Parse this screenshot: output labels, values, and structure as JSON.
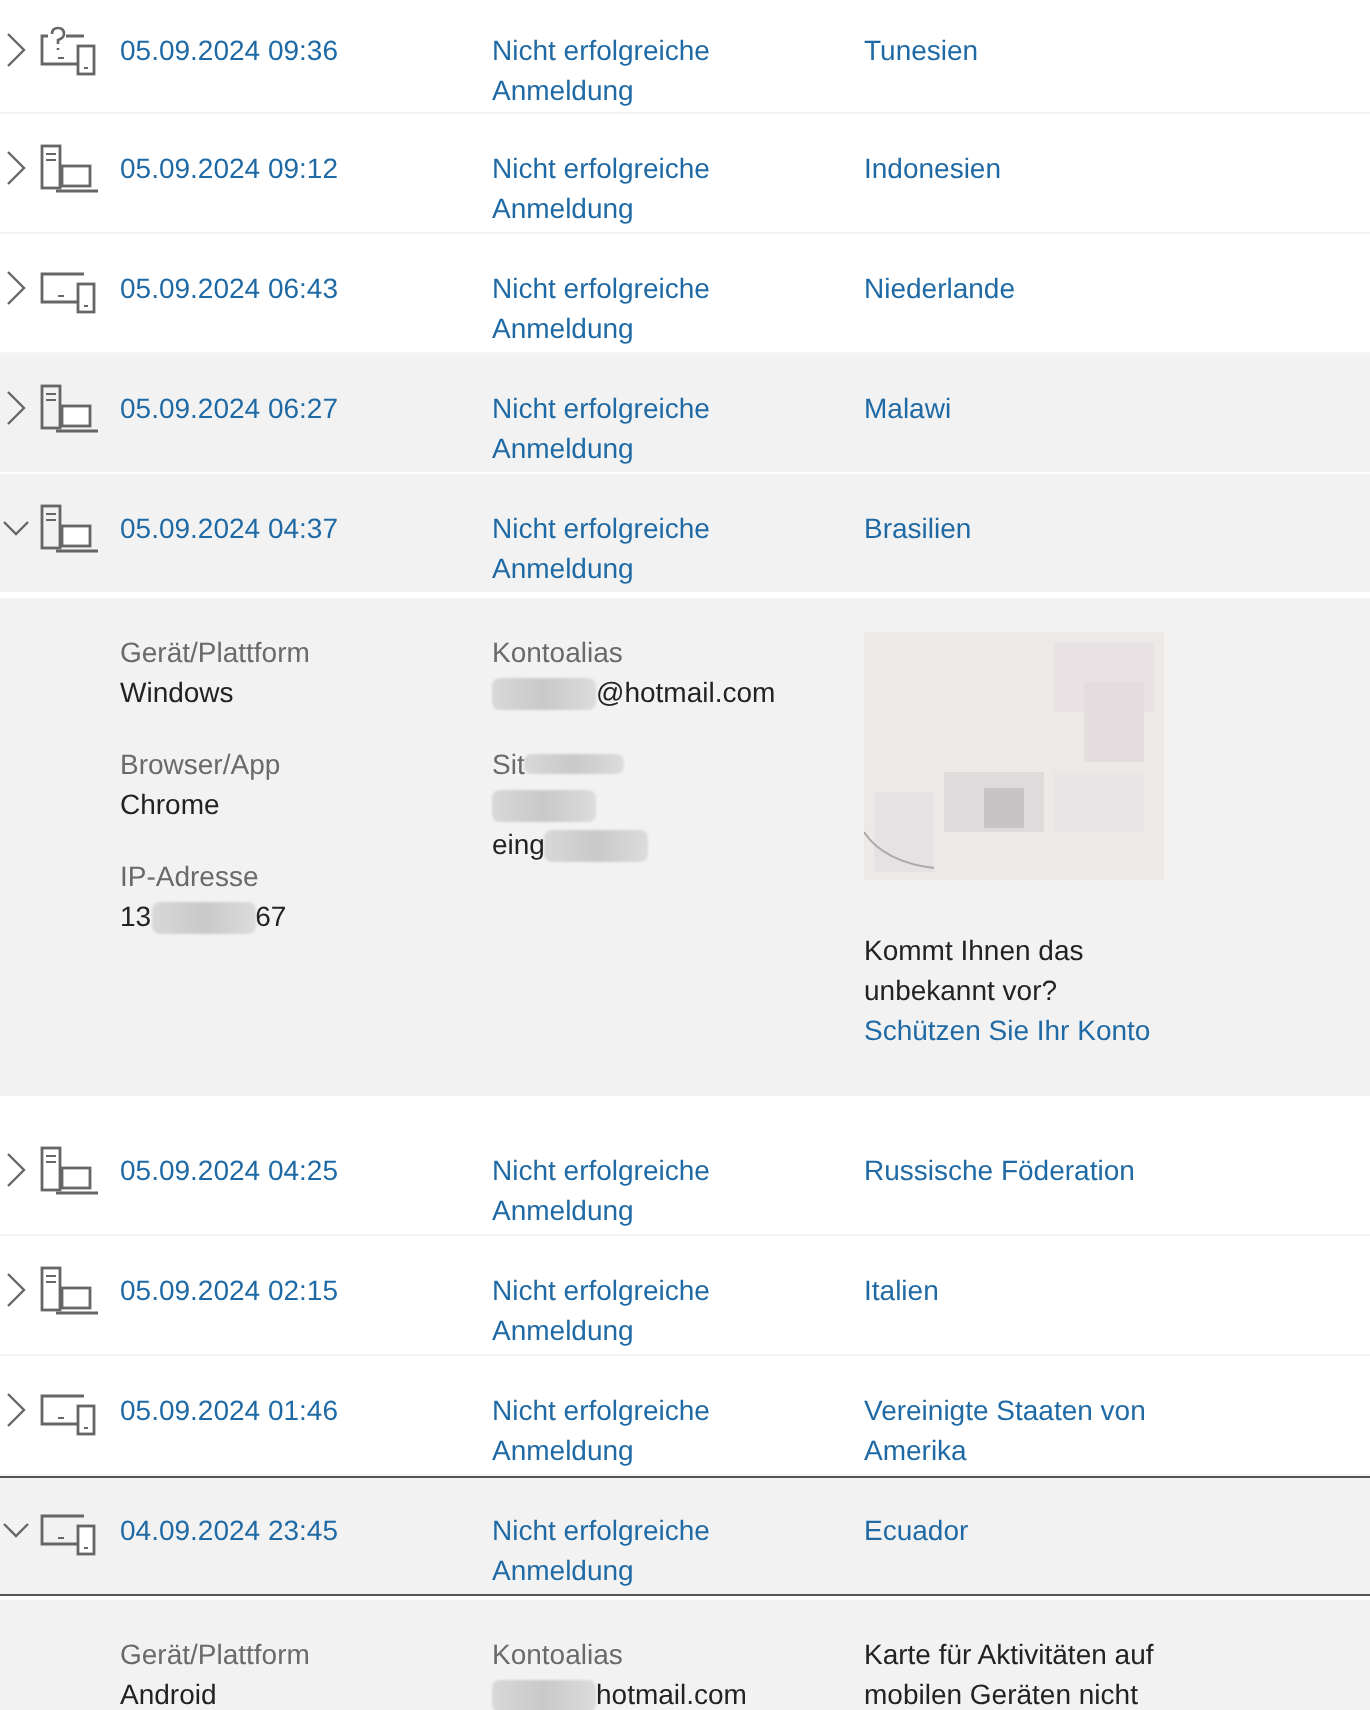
{
  "activities": [
    {
      "kind": "unknown",
      "date": "05.09.2024 09:36",
      "event": "Nicht erfolgreiche Anmeldung",
      "country": "Tunesien",
      "expanded": false,
      "hovered": false,
      "focused": false
    },
    {
      "kind": "desktop",
      "date": "05.09.2024 09:12",
      "event": "Nicht erfolgreiche Anmeldung",
      "country": "Indonesien",
      "expanded": false,
      "hovered": false,
      "focused": false
    },
    {
      "kind": "mobile",
      "date": "05.09.2024 06:43",
      "event": "Nicht erfolgreiche Anmeldung",
      "country": "Niederlande",
      "expanded": false,
      "hovered": false,
      "focused": false
    },
    {
      "kind": "desktop",
      "date": "05.09.2024 06:27",
      "event": "Nicht erfolgreiche Anmeldung",
      "country": "Malawi",
      "expanded": false,
      "hovered": true,
      "focused": false
    },
    {
      "kind": "desktop",
      "date": "05.09.2024 04:37",
      "event": "Nicht erfolgreiche Anmeldung",
      "country": "Brasilien",
      "expanded": true,
      "hovered": true,
      "focused": false,
      "details": {
        "columns": [
          [
            {
              "label": "Gerät/Plattform",
              "value": [
                {
                  "kind": "text",
                  "text": "Windows"
                }
              ]
            },
            {
              "label": "Browser/App",
              "value": [
                {
                  "kind": "text",
                  "text": "Chrome"
                }
              ]
            },
            {
              "label": "IP-Adresse",
              "value": [
                {
                  "kind": "text",
                  "text": "13"
                },
                {
                  "kind": "redacted"
                },
                {
                  "kind": "text",
                  "text": "67"
                }
              ]
            }
          ],
          [
            {
              "label": "Kontoalias",
              "value": [
                {
                  "kind": "redacted"
                },
                {
                  "kind": "text",
                  "text": "@hotmail.com"
                }
              ]
            },
            {
              "label": "Sit",
              "label_redacted": true,
              "value": [
                {
                  "kind": "redacted"
                },
                {
                  "kind": "break"
                },
                {
                  "kind": "text",
                  "text": "eing"
                },
                {
                  "kind": "redacted"
                }
              ]
            }
          ]
        ],
        "map": {
          "kind": "picture",
          "question": "Kommt Ihnen das unbekannt vor?",
          "link": "Schützen Sie Ihr Konto"
        }
      }
    },
    {
      "kind": "desktop",
      "date": "05.09.2024 04:25",
      "event": "Nicht erfolgreiche Anmeldung",
      "country": "Russische Föderation",
      "expanded": false,
      "hovered": false,
      "focused": false
    },
    {
      "kind": "desktop",
      "date": "05.09.2024 02:15",
      "event": "Nicht erfolgreiche Anmeldung",
      "country": "Italien",
      "expanded": false,
      "hovered": false,
      "focused": false
    },
    {
      "kind": "mobile",
      "date": "05.09.2024 01:46",
      "event": "Nicht erfolgreiche Anmeldung",
      "country": "Vereinigte Staaten von Amerika",
      "expanded": false,
      "hovered": false,
      "focused": false
    },
    {
      "kind": "mobile",
      "date": "04.09.2024 23:45",
      "event": "Nicht erfolgreiche Anmeldung",
      "country": "Ecuador",
      "expanded": true,
      "hovered": true,
      "focused": true,
      "details": {
        "columns": [
          [
            {
              "label": "Gerät/Plattform",
              "value": [
                {
                  "kind": "text",
                  "text": "Android"
                }
              ]
            }
          ],
          [
            {
              "label": "Kontoalias",
              "value": [
                {
                  "kind": "redacted"
                },
                {
                  "kind": "text",
                  "text": "hotmail.com"
                }
              ]
            }
          ]
        ],
        "map": {
          "kind": "note",
          "note": "Karte für Aktivitäten auf mobilen Geräten nicht"
        }
      }
    }
  ]
}
